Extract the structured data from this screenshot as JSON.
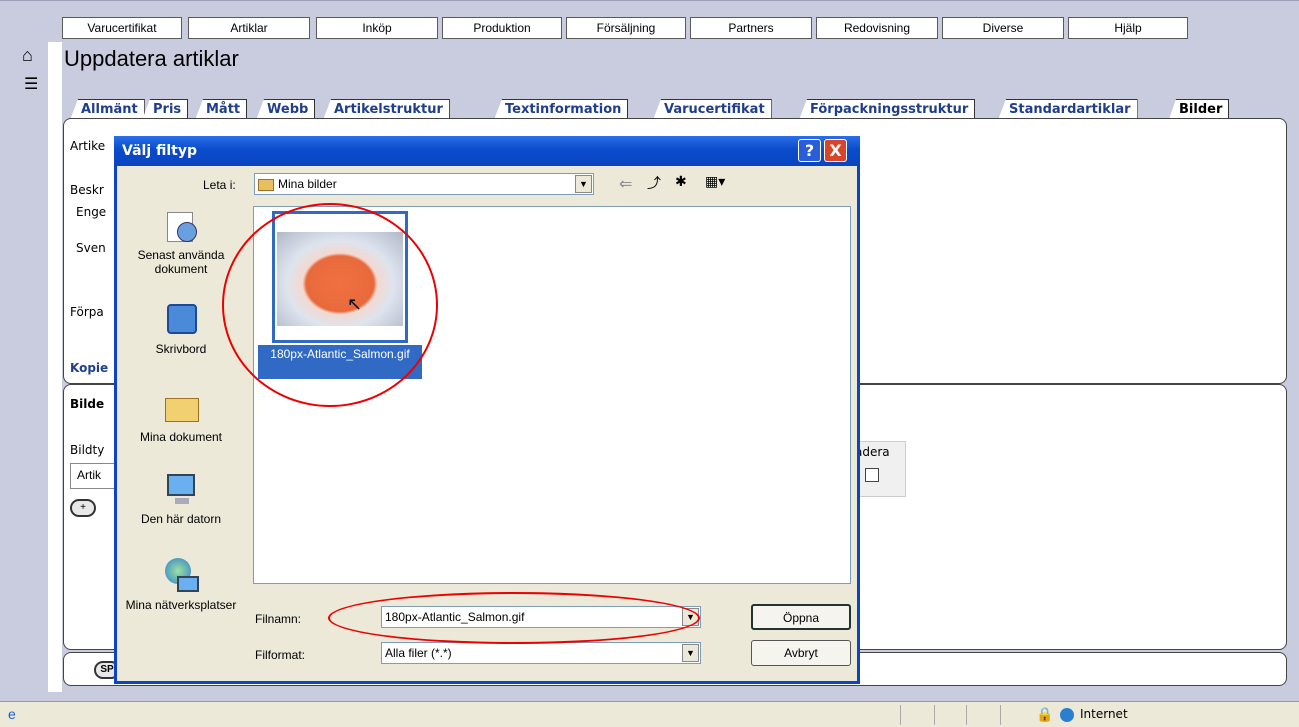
{
  "menu": {
    "items": [
      "Varucertifikat",
      "Artiklar",
      "Inköp",
      "Produktion",
      "Försäljning",
      "Partners",
      "Redovisning",
      "Diverse",
      "Hjälp"
    ]
  },
  "page": {
    "title": "Uppdatera artiklar"
  },
  "tabs": [
    "Allmänt",
    "Pris",
    "Mått",
    "Webb",
    "Artikelstruktur",
    "Textinformation",
    "Varucertifikat",
    "Förpackningsstruktur",
    "Standardartiklar",
    "Bilder"
  ],
  "form": {
    "labels": {
      "artikel": "Artike",
      "beskr": "Beskr",
      "enge": "Enge",
      "sven": "Sven",
      "forpa": "Förpa",
      "kopie": "Kopie",
      "bilde": "Bilde",
      "bildty": "Bildty",
      "artik": "Artik",
      "adera": "adera",
      "sp": "SP"
    }
  },
  "dialog": {
    "title": "Välj filtyp",
    "help": "?",
    "close": "X",
    "look_in_label": "Leta i:",
    "look_in_value": "Mina bilder",
    "places": [
      {
        "icon": "recent-documents-icon",
        "label": "Senast använda dokument"
      },
      {
        "icon": "desktop-icon",
        "label": "Skrivbord"
      },
      {
        "icon": "my-documents-icon",
        "label": "Mina dokument"
      },
      {
        "icon": "my-computer-icon",
        "label": "Den här datorn"
      },
      {
        "icon": "network-places-icon",
        "label": "Mina nätverksplatser"
      }
    ],
    "files": [
      {
        "name": "180px-Atlantic_Salmon.gif",
        "selected": true
      }
    ],
    "filename_label": "Filnamn:",
    "filename_value": "180px-Atlantic_Salmon.gif",
    "filetype_label": "Filformat:",
    "filetype_value": "Alla filer (*.*)",
    "open_button": "Öppna",
    "cancel_button": "Avbryt"
  },
  "statusbar": {
    "zone": "Internet"
  },
  "colors": {
    "dialog_title": "#0a4ccc",
    "tab_text": "#1f3e8c",
    "highlight_ellipse": "#e00000",
    "selected_file": "#316ac5"
  }
}
